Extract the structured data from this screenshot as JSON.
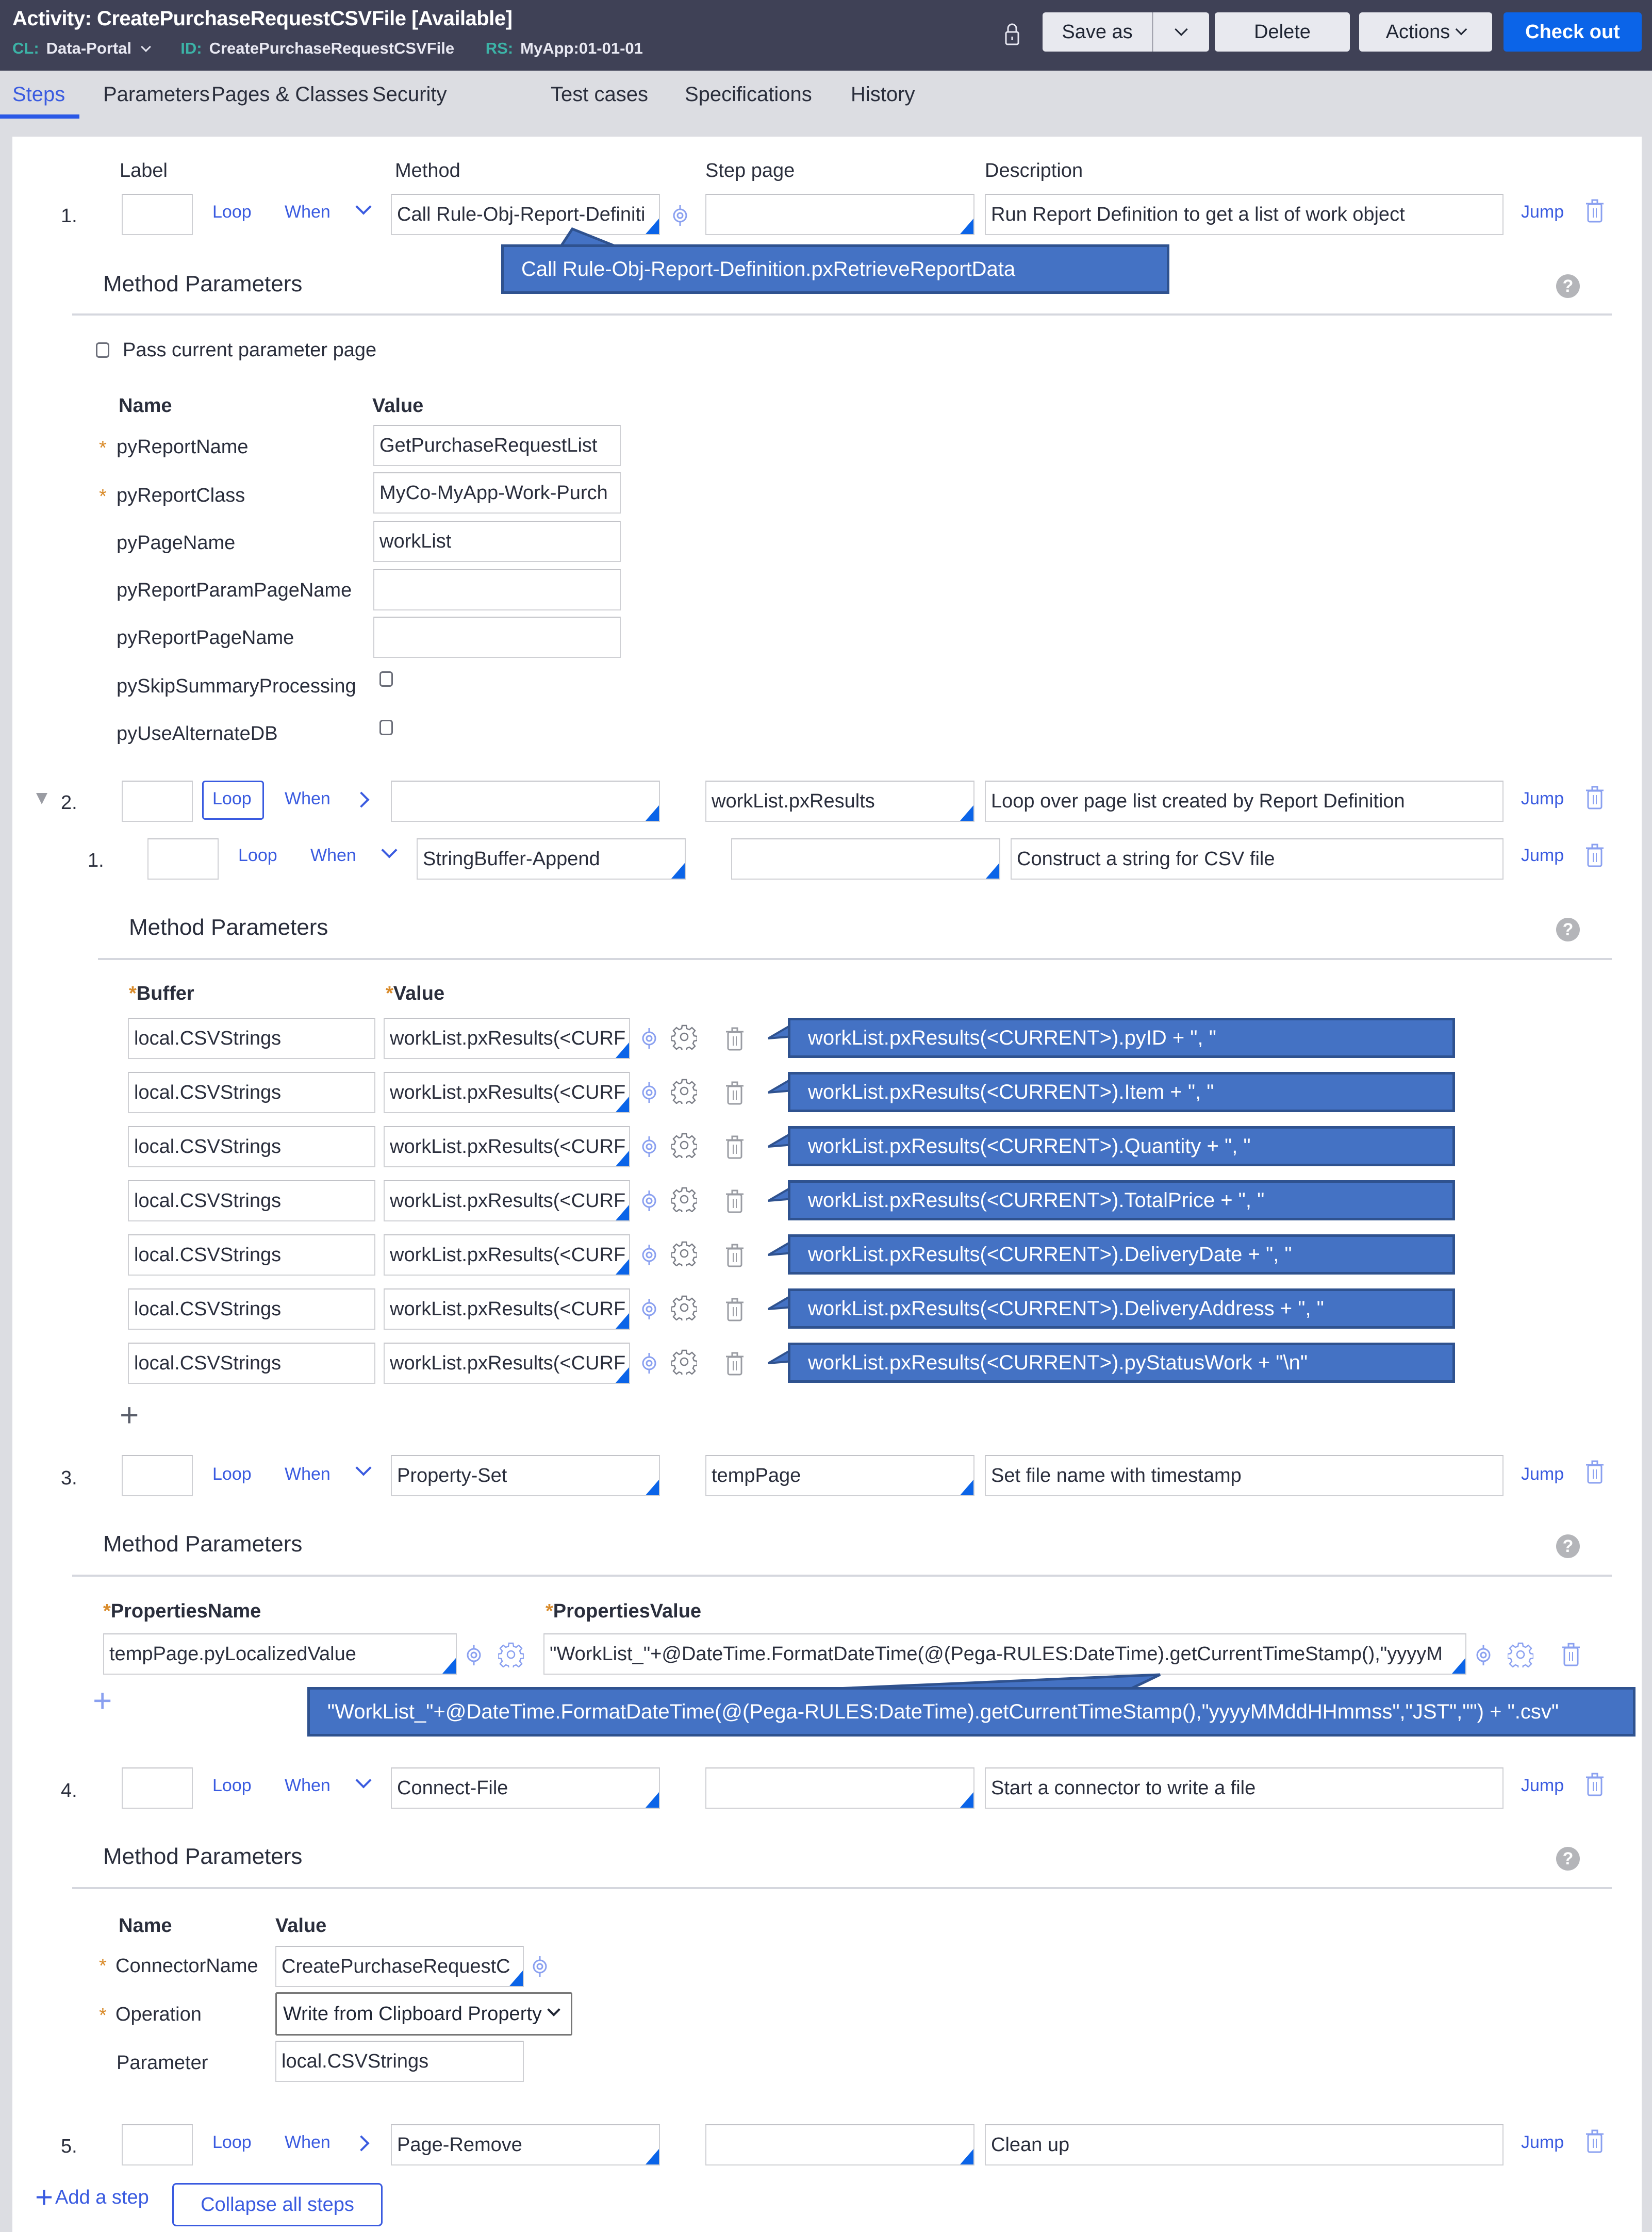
{
  "header": {
    "title": "Activity: CreatePurchaseRequestCSVFile [Available]",
    "cl_key": "CL:",
    "cl_value": "Data-Portal",
    "id_key": "ID:",
    "id_value": "CreatePurchaseRequestCSVFile",
    "rs_key": "RS:",
    "rs_value": "MyApp:01-01-01",
    "buttons": {
      "save_as": "Save as",
      "delete": "Delete",
      "actions": "Actions",
      "check_out": "Check out"
    }
  },
  "tabs": [
    "Steps",
    "Parameters",
    "Pages & Classes",
    "Security",
    "Test cases",
    "Specifications",
    "History"
  ],
  "active_tab": "Steps",
  "columns": {
    "label": "Label",
    "method": "Method",
    "step_page": "Step page",
    "description": "Description"
  },
  "common": {
    "loop": "Loop",
    "when": "When",
    "jump": "Jump",
    "method_parameters": "Method Parameters",
    "name": "Name",
    "value": "Value",
    "help": "?"
  },
  "steps": [
    {
      "number": "1.",
      "label": "",
      "method": "Call Rule-Obj-Report-Definiti",
      "step_page": "",
      "description": "Run Report Definition to get a list of work object",
      "callout": "Call Rule-Obj-Report-Definition.pxRetrieveReportData",
      "pass_current_param_page": "Pass current parameter page",
      "params": [
        {
          "name": "pyReportName",
          "required": true,
          "value": "GetPurchaseRequestList",
          "type": "text"
        },
        {
          "name": "pyReportClass",
          "required": true,
          "value": "MyCo-MyApp-Work-Purch",
          "type": "text"
        },
        {
          "name": "pyPageName",
          "required": false,
          "value": "workList",
          "type": "text"
        },
        {
          "name": "pyReportParamPageName",
          "required": false,
          "value": "",
          "type": "text"
        },
        {
          "name": "pyReportPageName",
          "required": false,
          "value": "",
          "type": "text"
        },
        {
          "name": "pySkipSummaryProcessing",
          "required": false,
          "checked": false,
          "type": "checkbox"
        },
        {
          "name": "pyUseAlternateDB",
          "required": false,
          "checked": false,
          "type": "checkbox"
        }
      ]
    },
    {
      "number": "2.",
      "label": "",
      "method": "",
      "step_page": "workList.pxResults",
      "description": "Loop over page list created by Report Definition",
      "substep": {
        "number": "1.",
        "label": "",
        "method": "StringBuffer-Append",
        "step_page": "",
        "description": "Construct a string for CSV file",
        "buffer_header": "Buffer",
        "value_header": "Value",
        "rows": [
          {
            "buffer": "local.CSVStrings",
            "value": "workList.pxResults(<CURF",
            "callout": "workList.pxResults(<CURRENT>).pyID + \", \""
          },
          {
            "buffer": "local.CSVStrings",
            "value": "workList.pxResults(<CURF",
            "callout": "workList.pxResults(<CURRENT>).Item + \", \""
          },
          {
            "buffer": "local.CSVStrings",
            "value": "workList.pxResults(<CURF",
            "callout": "workList.pxResults(<CURRENT>).Quantity + \", \""
          },
          {
            "buffer": "local.CSVStrings",
            "value": "workList.pxResults(<CURF",
            "callout": "workList.pxResults(<CURRENT>).TotalPrice + \", \""
          },
          {
            "buffer": "local.CSVStrings",
            "value": "workList.pxResults(<CURF",
            "callout": "workList.pxResults(<CURRENT>).DeliveryDate + \", \""
          },
          {
            "buffer": "local.CSVStrings",
            "value": "workList.pxResults(<CURF",
            "callout": "workList.pxResults(<CURRENT>).DeliveryAddress + \", \""
          },
          {
            "buffer": "local.CSVStrings",
            "value": "workList.pxResults(<CURF",
            "callout": "workList.pxResults(<CURRENT>).pyStatusWork + \"\\n\""
          }
        ]
      }
    },
    {
      "number": "3.",
      "label": "",
      "method": "Property-Set",
      "step_page": "tempPage",
      "description": "Set file name with timestamp",
      "name_header": "PropertiesName",
      "value_header": "PropertiesValue",
      "prop_name": "tempPage.pyLocalizedValue",
      "prop_value": "\"WorkList_\"+@DateTime.FormatDateTime(@(Pega-RULES:DateTime).getCurrentTimeStamp(),\"yyyyM",
      "callout": "\"WorkList_\"+@DateTime.FormatDateTime(@(Pega-RULES:DateTime).getCurrentTimeStamp(),\"yyyyMMddHHmmss\",\"JST\",\"\") + \".csv\""
    },
    {
      "number": "4.",
      "label": "",
      "method": "Connect-File",
      "step_page": "",
      "description": "Start a connector to write a file",
      "params": [
        {
          "name": "ConnectorName",
          "required": true,
          "value": "CreatePurchaseRequestC"
        },
        {
          "name": "Operation",
          "required": true,
          "value": "Write from Clipboard Property"
        },
        {
          "name": "Parameter",
          "required": false,
          "value": "local.CSVStrings"
        }
      ]
    },
    {
      "number": "5.",
      "label": "",
      "method": "Page-Remove",
      "step_page": "",
      "description": "Clean up"
    }
  ],
  "footer": {
    "add_step": "Add a step",
    "collapse_all": "Collapse all steps"
  }
}
